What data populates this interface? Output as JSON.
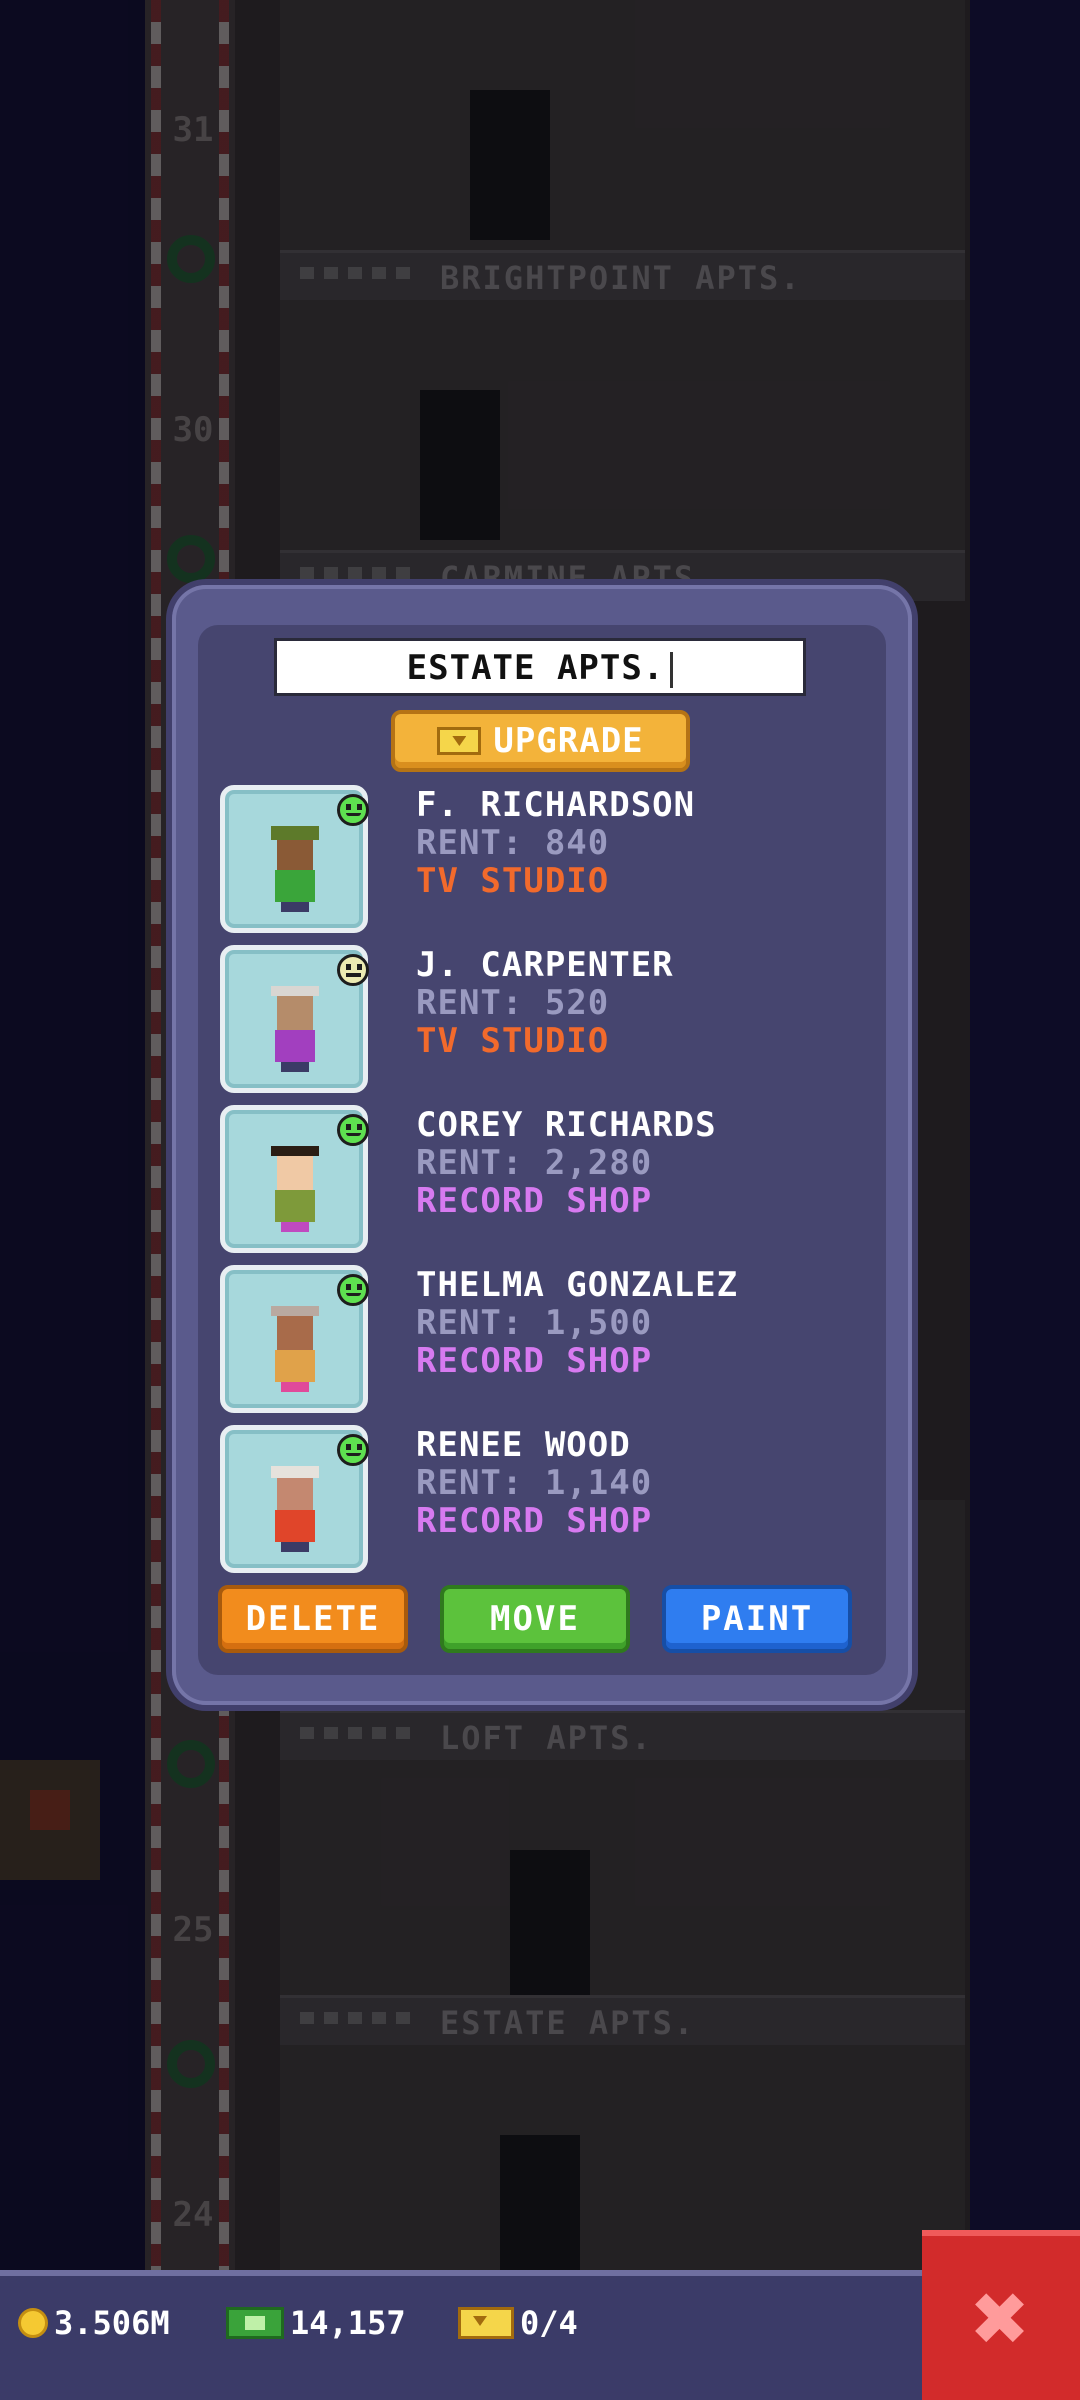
{
  "background": {
    "floor_numbers": [
      "31",
      "30",
      "25",
      "24"
    ],
    "floor_names": [
      "BRIGHTPOINT APTS.",
      "CARMINE APTS.",
      "LOFT APTS.",
      "ESTATE APTS."
    ]
  },
  "dialog": {
    "name_field_value": "ESTATE APTS.",
    "upgrade_label": "UPGRADE",
    "residents": [
      {
        "name": "F. RICHARDSON",
        "rent": "RENT: 840",
        "job": "TV STUDIO",
        "job_color": "#f26a2c",
        "mood": "happy"
      },
      {
        "name": "J. CARPENTER",
        "rent": "RENT: 520",
        "job": "TV STUDIO",
        "job_color": "#f26a2c",
        "mood": "neutral"
      },
      {
        "name": "COREY RICHARDS",
        "rent": "RENT: 2,280",
        "job": "RECORD SHOP",
        "job_color": "#d77af0",
        "mood": "happy"
      },
      {
        "name": "THELMA GONZALEZ",
        "rent": "RENT: 1,500",
        "job": "RECORD SHOP",
        "job_color": "#d77af0",
        "mood": "happy"
      },
      {
        "name": "RENEE WOOD",
        "rent": "RENT: 1,140",
        "job": "RECORD SHOP",
        "job_color": "#d77af0",
        "mood": "happy"
      }
    ],
    "buttons": {
      "delete": "DELETE",
      "move": "MOVE",
      "paint": "PAINT"
    }
  },
  "bottom_bar": {
    "coins": "3.506M",
    "bux": "14,157",
    "tickets": "0/4"
  },
  "icons": [
    "coin-icon",
    "bux-icon",
    "ticket-icon",
    "close-icon",
    "mood-icon"
  ]
}
